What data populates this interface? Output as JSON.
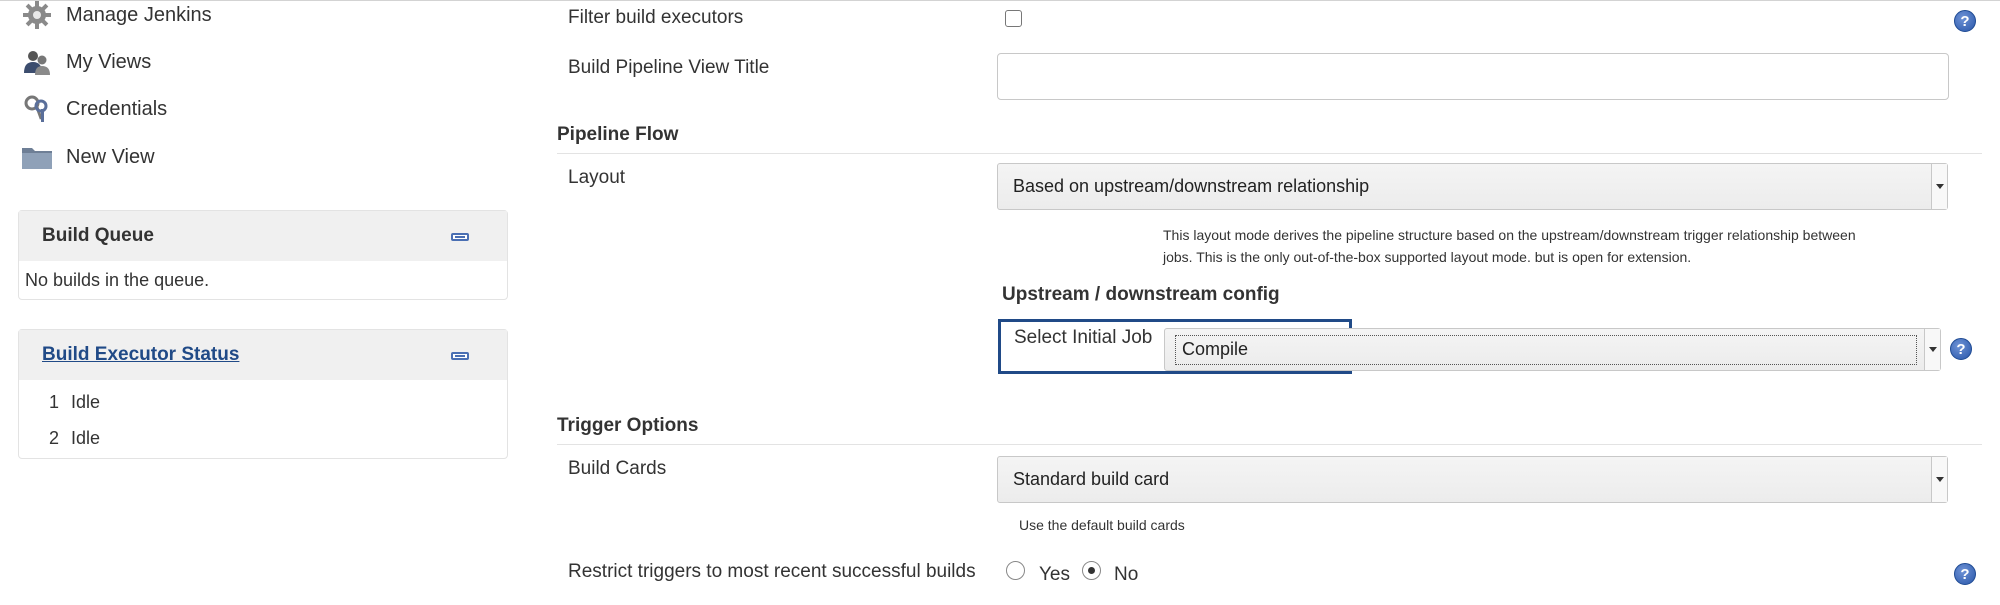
{
  "sidebar": {
    "tasks": [
      {
        "label": "Manage Jenkins",
        "icon": "gear-icon"
      },
      {
        "label": "My Views",
        "icon": "users-icon"
      },
      {
        "label": "Credentials",
        "icon": "keys-icon"
      },
      {
        "label": "New View",
        "icon": "folder-icon"
      }
    ],
    "build_queue": {
      "title": "Build Queue",
      "empty_text": "No builds in the queue."
    },
    "executor_status": {
      "title": "Build Executor Status",
      "executors": [
        {
          "number": "1",
          "status": "Idle"
        },
        {
          "number": "2",
          "status": "Idle"
        }
      ]
    }
  },
  "form": {
    "filter_executors_label": "Filter build executors",
    "view_title_label": "Build Pipeline View Title",
    "view_title_value": "",
    "pipeline_flow": {
      "section_title": "Pipeline Flow",
      "layout_label": "Layout",
      "layout_value": "Based on upstream/downstream relationship",
      "layout_help_line1": "This layout mode derives the pipeline structure based on the upstream/downstream trigger relationship between",
      "layout_help_line2": "jobs. This is the only out-of-the-box supported layout mode. but is open for extension.",
      "upstream_title": "Upstream / downstream config",
      "initial_job_label": "Select Initial Job",
      "initial_job_value": "Compile"
    },
    "trigger_options": {
      "section_title": "Trigger Options",
      "build_cards_label": "Build Cards",
      "build_cards_value": "Standard build card",
      "build_cards_help": "Use the default build cards",
      "restrict_label": "Restrict triggers to most recent successful builds",
      "restrict_yes": "Yes",
      "restrict_no": "No",
      "restrict_selected": "No"
    },
    "help_icon_glyph": "?"
  },
  "colors": {
    "focus_border": "#204a87",
    "link": "#204a87",
    "help_icon": "#2856a9"
  }
}
